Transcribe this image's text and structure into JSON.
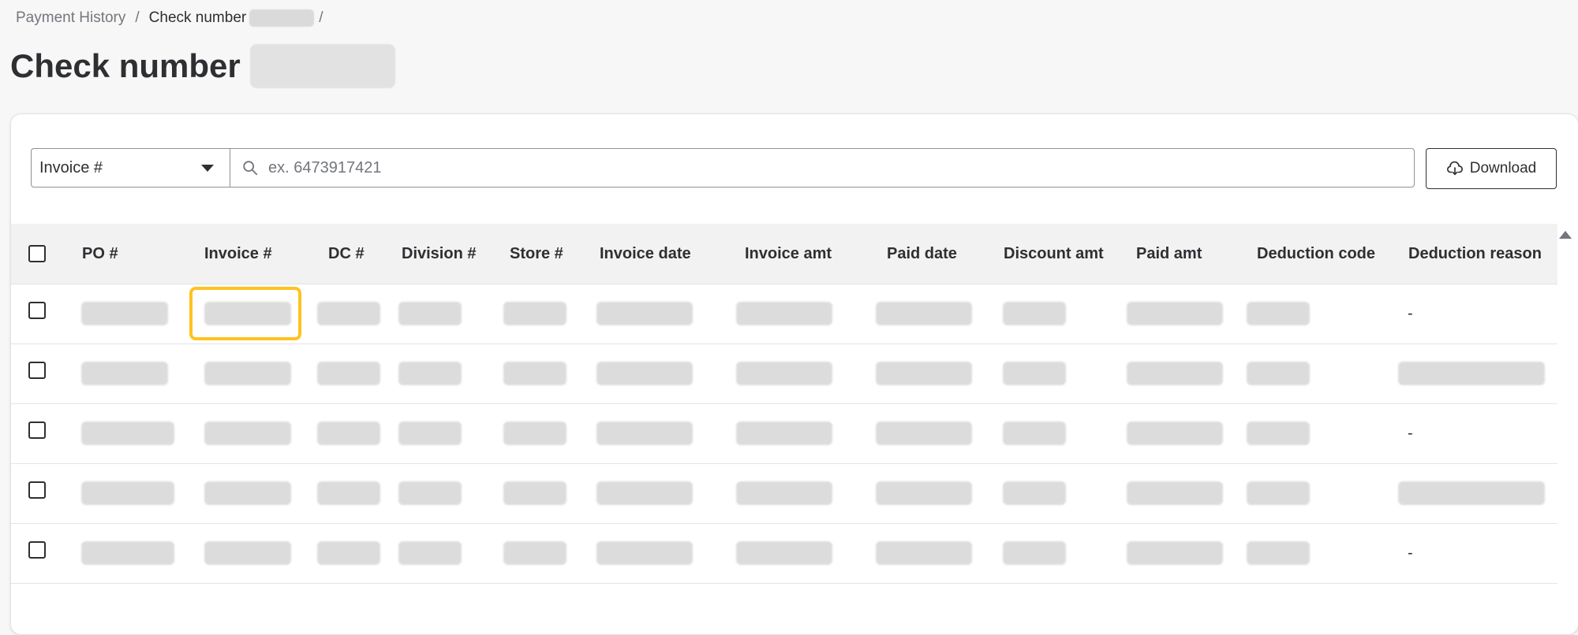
{
  "breadcrumb": {
    "items": [
      {
        "label": "Payment History"
      },
      {
        "label": "Check number"
      }
    ],
    "separator": "/"
  },
  "page": {
    "title": "Check number"
  },
  "filter": {
    "selected": "Invoice #",
    "search_placeholder": "ex. 6473917421",
    "download_label": "Download"
  },
  "table": {
    "columns": [
      "PO #",
      "Invoice #",
      "DC #",
      "Division #",
      "Store #",
      "Invoice date",
      "Invoice amt",
      "Paid date",
      "Discount amt",
      "Paid amt",
      "Deduction code",
      "Deduction reason"
    ],
    "rows": [
      {
        "deduction_reason": "-"
      },
      {
        "deduction_reason": ""
      },
      {
        "deduction_reason": "-"
      },
      {
        "deduction_reason": ""
      },
      {
        "deduction_reason": "-"
      }
    ]
  },
  "colors": {
    "highlight": "#ffc220",
    "text": "#2e2f32",
    "muted": "#74767c",
    "redaction": "#dcdcdc"
  },
  "icons": {
    "search": "search-icon",
    "download": "cloud-download-icon",
    "dropdown": "caret-down-icon",
    "scroll": "scroll-up-arrow-icon"
  }
}
